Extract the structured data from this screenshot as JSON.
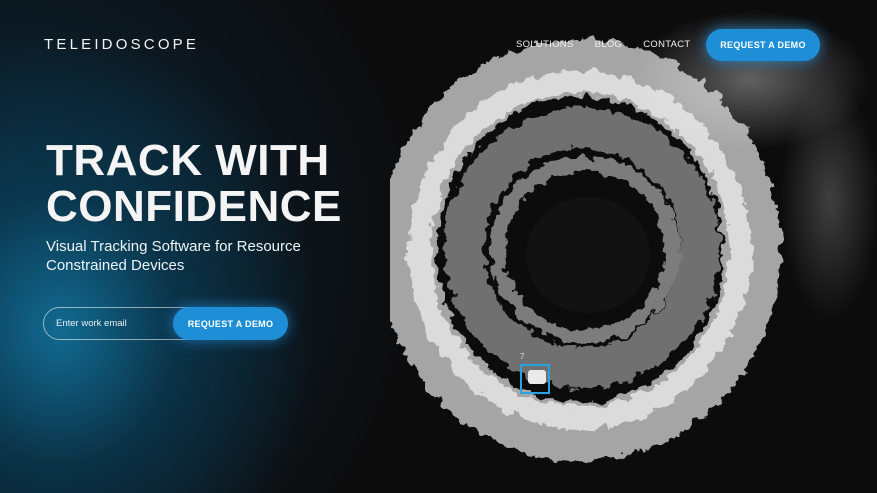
{
  "brand": {
    "name": "TELEIDOSCOPE"
  },
  "nav": {
    "links": [
      "SOLUTIONS",
      "BLOG",
      "CONTACT"
    ],
    "cta_label": "REQUEST A DEMO"
  },
  "hero": {
    "headline_line1": "TRACK WITH",
    "headline_line2": "CONFIDENCE",
    "subline_line1": "Visual Tracking Software for Resource",
    "subline_line2": "Constrained Devices",
    "email_placeholder": "Enter work email",
    "cta_label": "REQUEST A DEMO"
  },
  "tracking": {
    "id_label": "7"
  },
  "colors": {
    "accent": "#1e8fd6",
    "background": "#0c0c0d",
    "glow": "#0b5e86",
    "tracker_box": "#29a3e0"
  }
}
